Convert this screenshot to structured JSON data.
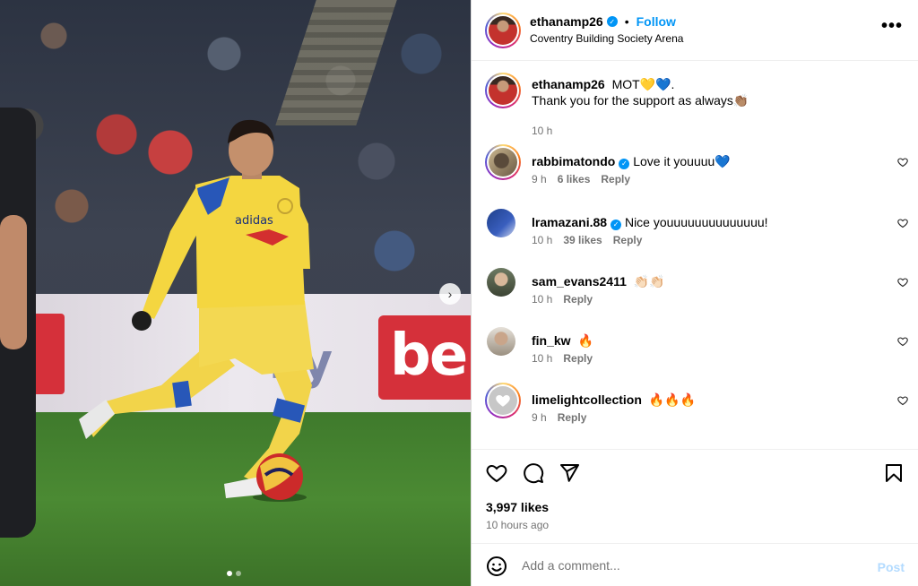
{
  "post": {
    "username": "ethanamp26",
    "separator": "•",
    "follow_label": "Follow",
    "location": "Coventry Building Society Arena",
    "more_label": "•••",
    "board_text": "be",
    "board_text_2": "ky",
    "verified_glyph": "✓"
  },
  "caption": {
    "username": "ethanamp26",
    "line1": "MOT💛💙.",
    "line2": "Thank you for the support as always👏🏽",
    "time": "10 h"
  },
  "comments": [
    {
      "username": "rabbimatondo",
      "verified": true,
      "text": "Love it youuuu💙",
      "time": "9 h",
      "likes": "6 likes",
      "reply": "Reply"
    },
    {
      "username": "lramazani.88",
      "verified": true,
      "text": "Nice youuuuuuuuuuuuuu!",
      "time": "10 h",
      "likes": "39 likes",
      "reply": "Reply"
    },
    {
      "username": "sam_evans2411",
      "verified": false,
      "text": "👏🏻👏🏻",
      "time": "10 h",
      "likes": "",
      "reply": "Reply"
    },
    {
      "username": "fin_kw",
      "verified": false,
      "text": "🔥",
      "time": "10 h",
      "likes": "",
      "reply": "Reply"
    },
    {
      "username": "limelightcollection",
      "verified": false,
      "text": "🔥🔥🔥",
      "time": "9 h",
      "likes": "",
      "reply": "Reply"
    }
  ],
  "stats": {
    "likes": "3,997 likes",
    "time_ago": "10 hours ago"
  },
  "add_comment": {
    "placeholder": "Add a comment...",
    "post_label": "Post"
  },
  "carousel": {
    "current": 1,
    "total": 2,
    "next_glyph": "›"
  },
  "icons": [
    "more-icon",
    "verified-icon",
    "heart-icon",
    "comment-icon",
    "share-icon",
    "bookmark-icon",
    "emoji-icon",
    "next-arrow-icon"
  ],
  "colors": {
    "accent": "#0095f6",
    "post_disabled": "#b3dbff",
    "meta": "#737373"
  }
}
